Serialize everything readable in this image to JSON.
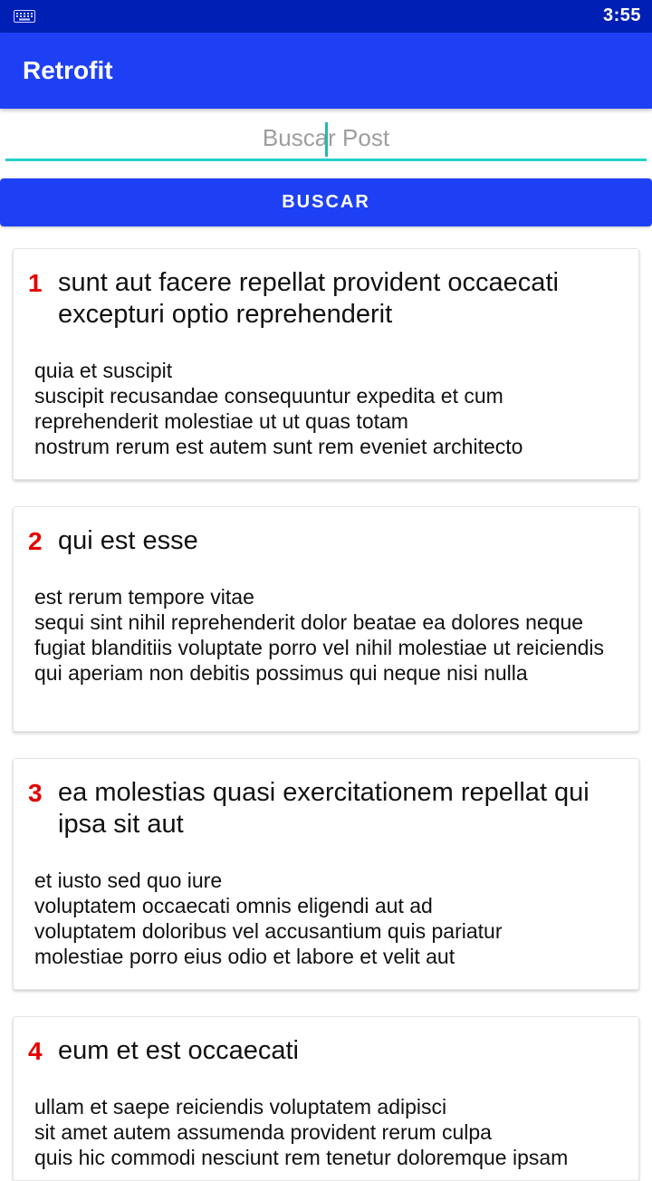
{
  "status_bar": {
    "time": "3:55",
    "left_icon": "keyboard-icon"
  },
  "app_bar": {
    "title": "Retrofit"
  },
  "search": {
    "placeholder": "Buscar Post",
    "value": "",
    "button_label": "BUSCAR"
  },
  "colors": {
    "app_bar": "#1e40f5",
    "status_bar": "#0020b5",
    "accent": "#25d0c6",
    "post_id": "#e50000"
  },
  "posts": [
    {
      "id": "1",
      "title": "sunt aut facere repellat provident occaecati excepturi optio reprehenderit",
      "body": "quia et suscipit\nsuscipit recusandae consequuntur expedita et cum\nreprehenderit molestiae ut ut quas totam\nnostrum rerum est autem sunt rem eveniet architecto"
    },
    {
      "id": "2",
      "title": "qui est esse",
      "body": "est rerum tempore vitae\nsequi sint nihil reprehenderit dolor beatae ea dolores neque\nfugiat blanditiis voluptate porro vel nihil molestiae ut reiciendis\nqui aperiam non debitis possimus qui neque nisi nulla"
    },
    {
      "id": "3",
      "title": "ea molestias quasi exercitationem repellat qui ipsa sit aut",
      "body": "et iusto sed quo iure\nvoluptatem occaecati omnis eligendi aut ad\nvoluptatem doloribus vel accusantium quis pariatur\nmolestiae porro eius odio et labore et velit aut"
    },
    {
      "id": "4",
      "title": "eum et est occaecati",
      "body": "ullam et saepe reiciendis voluptatem adipisci\nsit amet autem assumenda provident rerum culpa\nquis hic commodi nesciunt rem tenetur doloremque ipsam"
    }
  ]
}
